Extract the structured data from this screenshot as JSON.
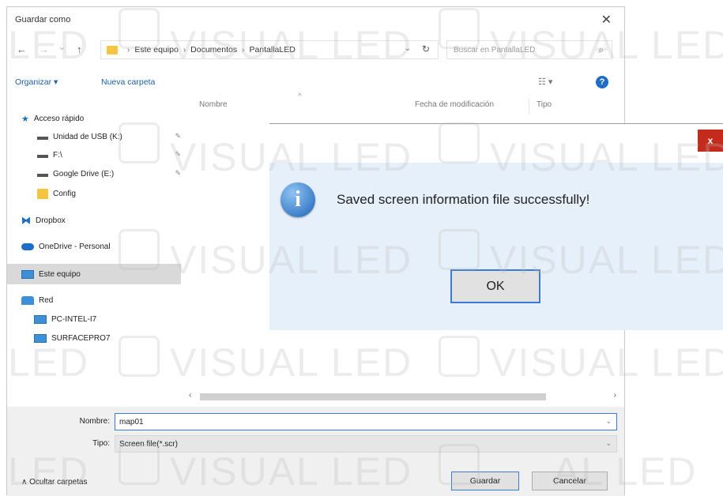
{
  "dialog": {
    "title": "Guardar como",
    "close_glyph": "✕",
    "nav": {
      "back": "←",
      "forward": "→",
      "recent": "⌄",
      "up": "↑"
    },
    "breadcrumb": [
      "Este equipo",
      "Documentos",
      "PantallaLED"
    ],
    "breadcrumb_sep": "›",
    "address_dropdown": "⌄",
    "refresh_glyph": "↻",
    "search_placeholder": "Buscar en PantallaLED",
    "search_glyph": "⌕",
    "toolbar": {
      "organize": "Organizar ▾",
      "new_folder": "Nueva carpeta",
      "view_glyph": "☷ ▾",
      "help_glyph": "?"
    },
    "sidebar": [
      {
        "label": "Acceso rápido",
        "icon": "star-icon",
        "pinned": false
      },
      {
        "label": "Unidad de USB (K:)",
        "icon": "drive-icon",
        "pinned": true
      },
      {
        "label": "F:\\",
        "icon": "drive-icon",
        "pinned": true
      },
      {
        "label": "Google Drive (E:)",
        "icon": "drive-icon",
        "pinned": true
      },
      {
        "label": "Config",
        "icon": "folder-icon",
        "pinned": false
      },
      {
        "label": "Dropbox",
        "icon": "dropbox-icon",
        "pinned": false
      },
      {
        "label": "OneDrive - Personal",
        "icon": "cloud-icon",
        "pinned": false
      },
      {
        "label": "Este equipo",
        "icon": "pc-icon",
        "pinned": false,
        "selected": true
      },
      {
        "label": "Red",
        "icon": "network-icon",
        "pinned": false
      },
      {
        "label": "PC-INTEL-I7",
        "icon": "pc-icon",
        "pinned": false
      },
      {
        "label": "SURFACEPRO7",
        "icon": "pc-icon",
        "pinned": false
      }
    ],
    "pin_glyph": "✎",
    "columns": {
      "name": "Nombre",
      "modified": "Fecha de modificación",
      "type": "Tipo",
      "sort_glyph": "^"
    },
    "scroll": {
      "left": "‹",
      "right": "›"
    },
    "filename_label": "Nombre:",
    "filename_value": "map01",
    "filetype_label": "Tipo:",
    "filetype_value": "Screen file(*.scr)",
    "dropdown_glyph": "⌄",
    "hide_folders": "∧  Ocultar carpetas",
    "save_button": "Guardar",
    "cancel_button": "Cancelar"
  },
  "message_box": {
    "close_label": "x",
    "icon_glyph": "i",
    "text": "Saved screen information file successfully!",
    "ok_button": "OK"
  },
  "watermark": {
    "text_visual": "VISUAL LED",
    "text_led": "LED",
    "text_al_led": "AL LED"
  },
  "colors": {
    "accent": "#1f6ec6",
    "close_red": "#c42b1c",
    "message_bg": "#e6f0fa",
    "folder_yellow": "#f5c542",
    "selected_bg": "#d9d9d9",
    "bottom_band": "#f0f0f0"
  }
}
